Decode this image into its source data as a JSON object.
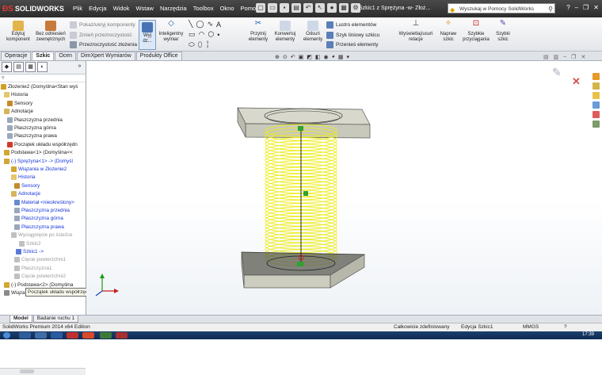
{
  "app": {
    "name": "SOLIDWORKS",
    "document_title": "Szkic1 z Sprężyna -w- Złoż..."
  },
  "menu": [
    "Plik",
    "Edycja",
    "Widok",
    "Wstaw",
    "Narzędzia",
    "Toolbox",
    "Okno",
    "Pomoc"
  ],
  "help_search": {
    "placeholder": "Wyszukaj w Pomocy SolidWorks"
  },
  "ribbon": {
    "edit_component": "Edytuj komponent",
    "no_external_refs": "Bez odniesień zewnętrznych",
    "show_hide_components": "Pokaż/ukryj komponenty",
    "change_transparency": "Zmień przezroczystość",
    "assembly_transparency": "Przezroczystość złożenia",
    "exit_sketch": "Wyj dz...",
    "smart_dimension": "Inteligentny wymiar",
    "trim_entities": "Przytnij elementy",
    "convert_entities": "Konwertuj elementy",
    "offset_entities": "Odsuń elementy",
    "mirror_entities": "Lustro elementów",
    "linear_pattern": "Szyk liniowy szkicu",
    "move_entities": "Przenieś elementy",
    "display_relations": "Wyświetlaj/usuń relacje",
    "repair_sketch": "Napraw szkic",
    "quick_snaps": "Szybkie przyciągania",
    "rapid_sketch": "Szybki szkic"
  },
  "tabs": [
    "Operacje",
    "Szkic",
    "Ocen",
    "DimXpert Wymiarów",
    "Produkty Office"
  ],
  "active_tab": "Szkic",
  "tree": [
    {
      "label": "Złożenie2 (Domyślna<Stan wyś",
      "color": "#222222"
    },
    {
      "label": "Historia",
      "color": "#222222"
    },
    {
      "label": "Sensory",
      "color": "#222222"
    },
    {
      "label": "Adnotacje",
      "color": "#222222"
    },
    {
      "label": "Płaszczyzna przednia",
      "color": "#222222"
    },
    {
      "label": "Płaszczyzna górna",
      "color": "#222222"
    },
    {
      "label": "Płaszczyzna prawa",
      "color": "#222222"
    },
    {
      "label": "Początek układu współrzędn",
      "color": "#222222"
    },
    {
      "label": "Podstawa<1> (Domyślna<<",
      "color": "#222222"
    },
    {
      "label": "(-) Sprężyna<1> -> (Domyśl",
      "color": "#1636d8"
    },
    {
      "label": "Wiązania w Złożenie2",
      "color": "#1636d8"
    },
    {
      "label": "Historia",
      "color": "#1636d8"
    },
    {
      "label": "Sensory",
      "color": "#1636d8"
    },
    {
      "label": "Adnotacje",
      "color": "#1636d8"
    },
    {
      "label": "Materiał <nieokreślony>",
      "color": "#1636d8"
    },
    {
      "label": "Płaszczyzna przednia",
      "color": "#1636d8"
    },
    {
      "label": "Płaszczyzna górna",
      "color": "#1636d8"
    },
    {
      "label": "Płaszczyzna prawa",
      "color": "#1636d8"
    },
    {
      "label": "Wyciągnięcie po ścieżce",
      "color": "#9a9a9a"
    },
    {
      "label": "Szkic2",
      "color": "#9a9a9a"
    },
    {
      "label": "Szkic1 ->",
      "color": "#1636d8"
    },
    {
      "label": "Cięcie powierzchni1",
      "color": "#9a9a9a"
    },
    {
      "label": "Płaszczyzna1",
      "color": "#9a9a9a"
    },
    {
      "label": "Cięcie powierzchni2",
      "color": "#9a9a9a"
    },
    {
      "label": "(-) Podstawa<2> (Domyślna",
      "color": "#222222"
    },
    {
      "label": "Wiązania",
      "color": "#222222"
    }
  ],
  "tooltip": "Początek układu współrzędnych",
  "bottom_tabs": [
    "Model",
    "Badanie ruchu 1"
  ],
  "status": {
    "edition": "SolidWorks Premium 2014 x64 Edition",
    "defined": "Całkowicie zdefiniowany",
    "editing": "Edycja Szkic1",
    "units": "MMGS",
    "clock": "17:39"
  },
  "colors": {
    "spring": "#ecec1a",
    "plate": "#d8d8cc",
    "accent_blue": "#1636d8"
  }
}
